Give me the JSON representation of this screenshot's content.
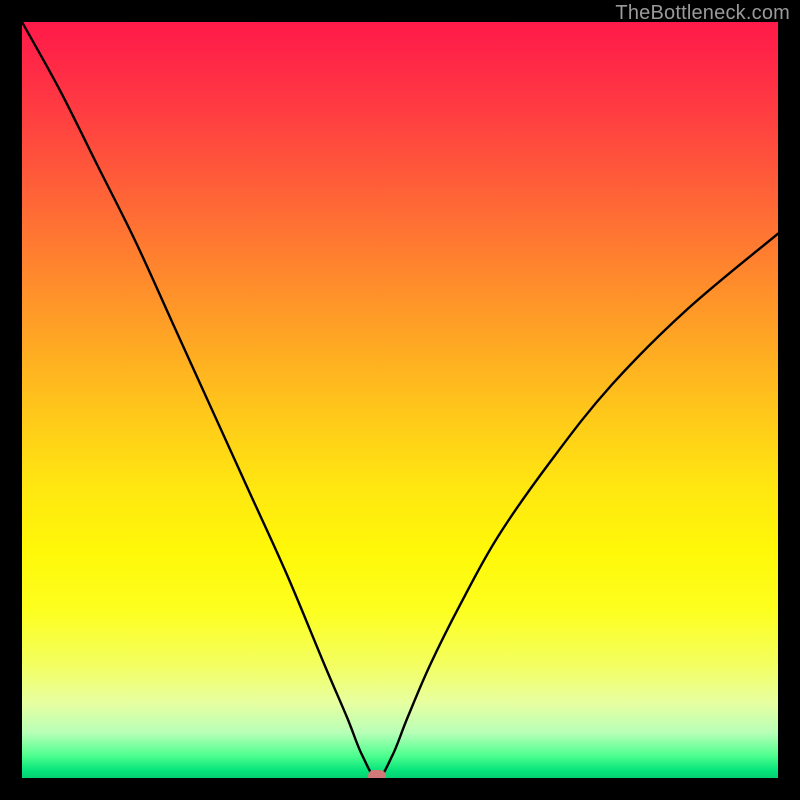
{
  "watermark": "TheBottleneck.com",
  "colors": {
    "curve_stroke": "#000000",
    "marker_fill": "#cf7a78",
    "frame_bg": "#000000"
  },
  "chart_data": {
    "type": "line",
    "title": "",
    "xlabel": "",
    "ylabel": "",
    "xlim": [
      0,
      100
    ],
    "ylim": [
      0,
      100
    ],
    "grid": false,
    "legend": false,
    "note": "y-axis is inverted visually (0 at bottom = green = no bottleneck, 100 at top = red = severe bottleneck). Values below are bottleneck-percentage readings estimated from the curve against the color gradient.",
    "marker": {
      "x": 47,
      "y": 0
    },
    "series": [
      {
        "name": "bottleneck",
        "x": [
          0,
          5,
          10,
          15,
          20,
          25,
          30,
          35,
          40,
          43,
          45,
          47,
          49,
          51,
          54,
          58,
          63,
          70,
          78,
          88,
          100
        ],
        "y": [
          100,
          91,
          81,
          71,
          60,
          49,
          38,
          27,
          15,
          8,
          3,
          0,
          3,
          8,
          15,
          23,
          32,
          42,
          52,
          62,
          72
        ]
      }
    ]
  }
}
